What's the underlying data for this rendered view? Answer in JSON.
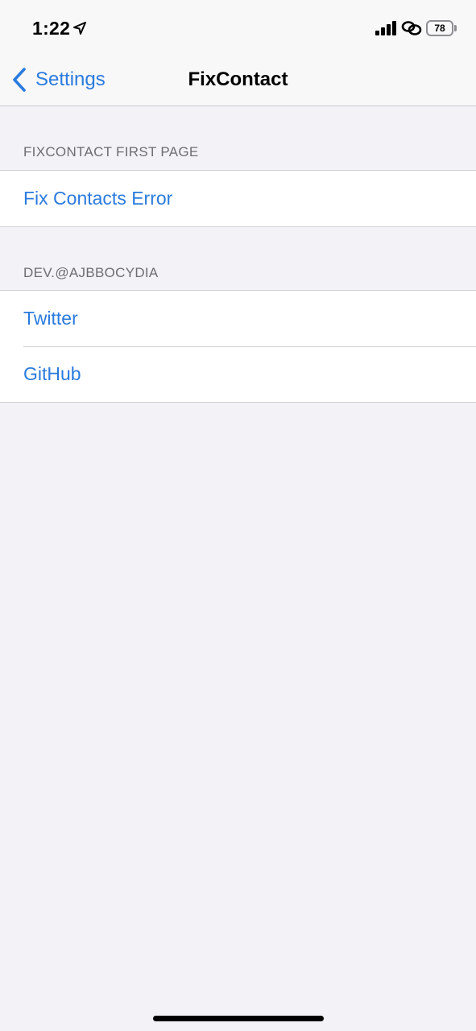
{
  "status_bar": {
    "time": "1:22",
    "battery": "78",
    "icons": [
      "location-arrow-icon",
      "cellular-signal-icon",
      "chain-link-icon",
      "battery-icon"
    ]
  },
  "nav": {
    "back_label": "Settings",
    "title": "FixContact"
  },
  "sections": [
    {
      "header": "FIXCONTACT FIRST PAGE",
      "items": [
        {
          "label": "Fix Contacts Error"
        }
      ]
    },
    {
      "header": "DEV.@AJBBOCYDIA",
      "items": [
        {
          "label": "Twitter"
        },
        {
          "label": "GitHub"
        }
      ]
    }
  ],
  "colors": {
    "accent": "#2a7bde",
    "background": "#f2f2f7",
    "cell_background": "#ffffff",
    "section_header_text": "#6d6d72",
    "separator": "#d1d1d6"
  }
}
